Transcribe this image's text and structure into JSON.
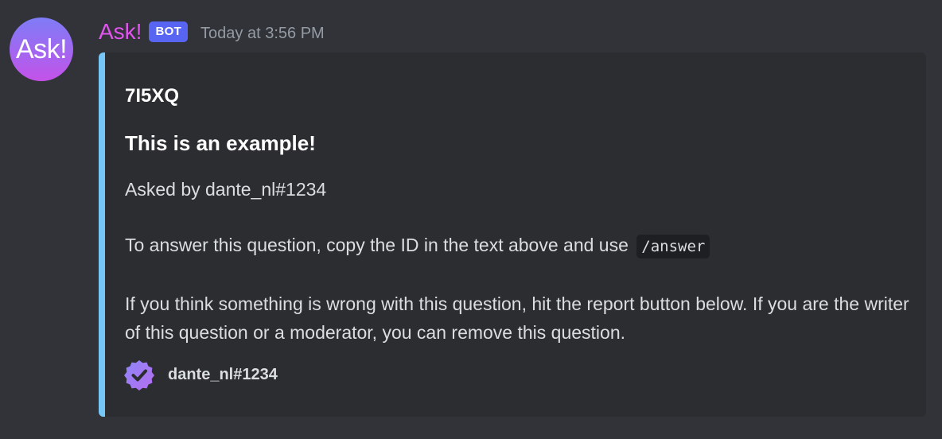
{
  "author": {
    "avatar_text": "Ask!",
    "username": "Ask!",
    "bot_tag": "BOT",
    "timestamp": "Today at 3:56 PM"
  },
  "embed": {
    "accent_color": "#76c7f7",
    "title": "7I5XQ",
    "heading": "This is an example!",
    "asked_by": "Asked by dante_nl#1234",
    "answer_instruction": "To answer this question, copy the ID in the text above and use",
    "command": "/answer",
    "report_text": "If you think something is wrong with this question, hit the report button below. If you are the writer of this question or a moderator, you can remove this question.",
    "footer": {
      "icon": "verified-badge-icon",
      "text": "dante_nl#1234"
    }
  }
}
